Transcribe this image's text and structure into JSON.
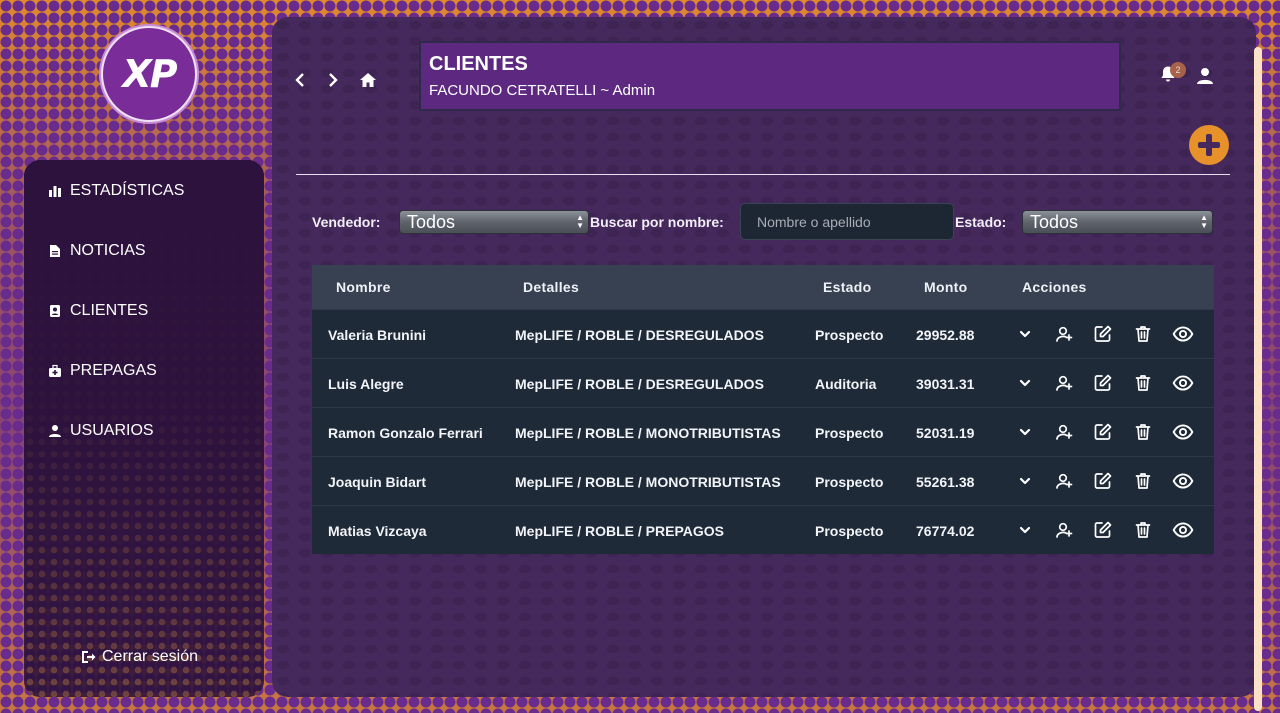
{
  "logo": {
    "text": "XP"
  },
  "sidebar": {
    "items": [
      {
        "label": "ESTADÍSTICAS",
        "icon": "bar-chart-icon"
      },
      {
        "label": "NOTICIAS",
        "icon": "document-icon"
      },
      {
        "label": "CLIENTES",
        "icon": "address-book-icon"
      },
      {
        "label": "PREPAGAS",
        "icon": "medkit-icon"
      },
      {
        "label": "USUARIOS",
        "icon": "user-icon"
      }
    ],
    "logout_label": "Cerrar sesión"
  },
  "header": {
    "title": "CLIENTES",
    "subtitle": "FACUNDO CETRATELLI ~ Admin",
    "notifications_count": "2"
  },
  "filters": {
    "vendedor_label": "Vendedor:",
    "vendedor_value": "Todos",
    "search_label": "Buscar por nombre:",
    "search_placeholder": "Nombre o apellido",
    "estado_label": "Estado:",
    "estado_value": "Todos"
  },
  "table": {
    "columns": [
      "Nombre",
      "Detalles",
      "Estado",
      "Monto",
      "Acciones"
    ],
    "rows": [
      {
        "nombre": "Valeria Brunini",
        "detalles": "MepLIFE / ROBLE / DESREGULADOS",
        "estado": "Prospecto",
        "monto": "29952.88"
      },
      {
        "nombre": "Luis Alegre",
        "detalles": "MepLIFE / ROBLE / DESREGULADOS",
        "estado": "Auditoria",
        "monto": "39031.31"
      },
      {
        "nombre": "Ramon Gonzalo Ferrari",
        "detalles": "MepLIFE / ROBLE / MONOTRIBUTISTAS",
        "estado": "Prospecto",
        "monto": "52031.19"
      },
      {
        "nombre": "Joaquin Bidart",
        "detalles": "MepLIFE / ROBLE / MONOTRIBUTISTAS",
        "estado": "Prospecto",
        "monto": "55261.38"
      },
      {
        "nombre": "Matias Vizcaya",
        "detalles": "MepLIFE / ROBLE / PREPAGOS",
        "estado": "Prospecto",
        "monto": "76774.02"
      }
    ]
  },
  "colors": {
    "accent_orange": "#e6912a",
    "purple_bg": "#45285c",
    "header_purple": "#5c2880",
    "table_row": "#1f2a38",
    "table_head": "#374152"
  }
}
